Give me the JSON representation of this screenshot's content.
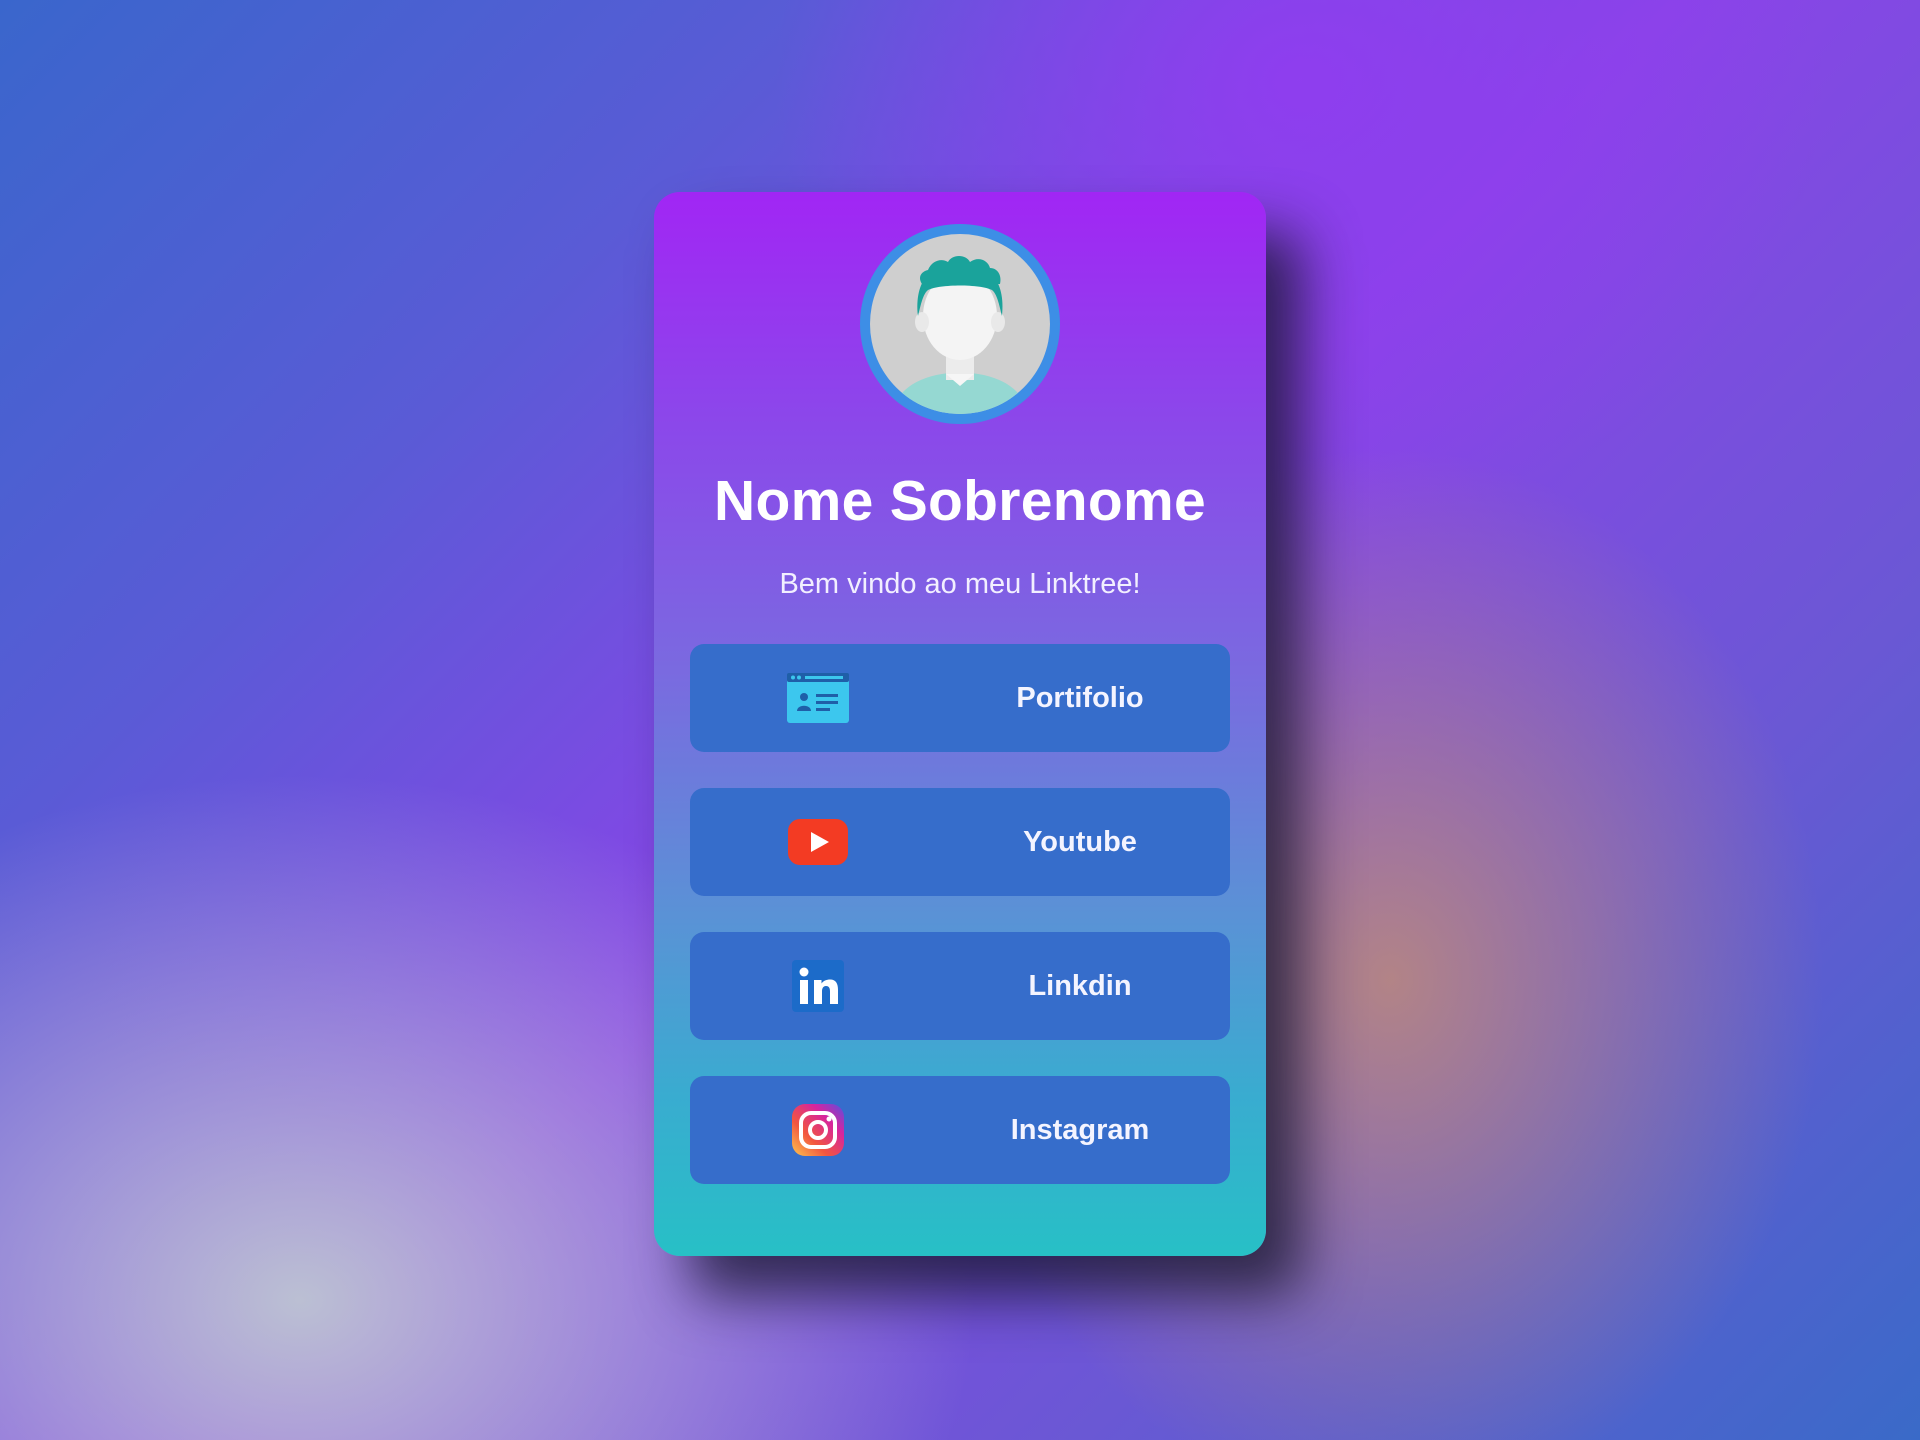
{
  "profile": {
    "name": "Nome Sobrenome",
    "subtitle": "Bem vindo ao meu Linktree!",
    "avatar_icon": "user-avatar-icon"
  },
  "links": [
    {
      "label": "Portifolio",
      "icon": "portfolio-icon"
    },
    {
      "label": "Youtube",
      "icon": "youtube-icon"
    },
    {
      "label": "Linkdin",
      "icon": "linkedin-icon"
    },
    {
      "label": "Instagram",
      "icon": "instagram-icon"
    }
  ],
  "colors": {
    "card_top": "#a126f4",
    "card_bottom": "#27c0c6",
    "button_bg": "#366dcb",
    "avatar_ring": "#3d8ee6"
  }
}
